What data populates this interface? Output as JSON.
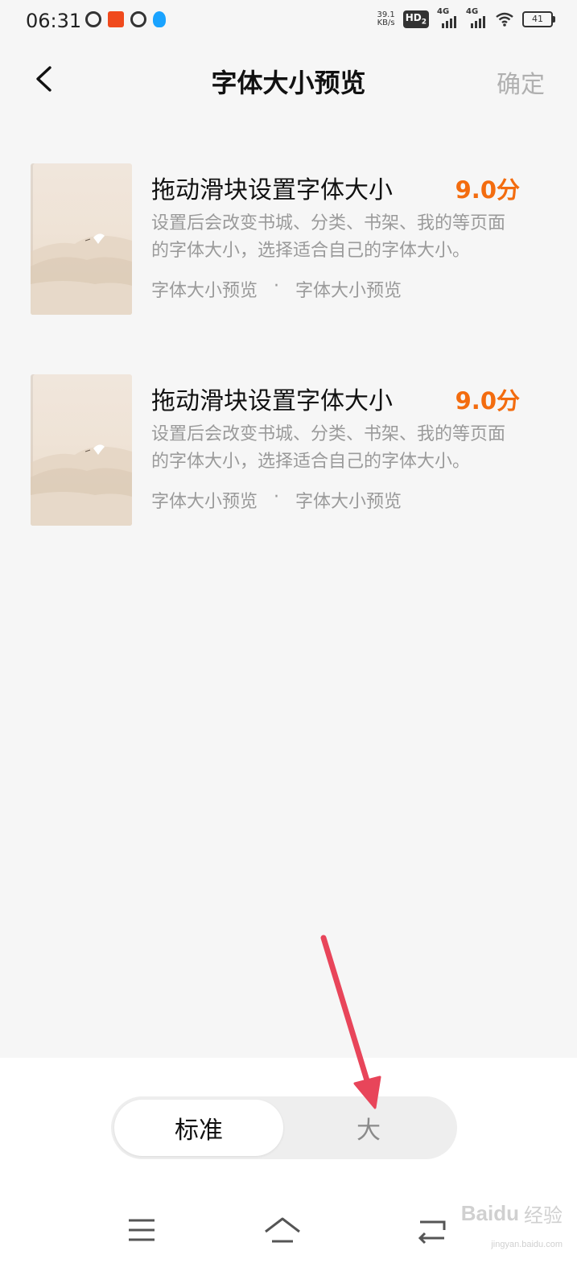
{
  "status_bar": {
    "time": "06:31",
    "net_speed_value": "39.1",
    "net_speed_unit": "KB/s",
    "hd_label": "HD",
    "hd_sub": "2",
    "sig1_label": "4G",
    "sig2_label": "4G",
    "battery": "41",
    "icons": [
      "q-app-icon",
      "red-app-icon",
      "clock-app-icon",
      "qq-icon",
      "hd-icon",
      "signal-icon",
      "signal-icon",
      "wifi-icon",
      "battery-icon"
    ]
  },
  "header": {
    "title": "字体大小预览",
    "confirm_label": "确定",
    "back_icon": "chevron-left-icon"
  },
  "books": [
    {
      "title": "拖动滑块设置字体大小",
      "score": "9.0分",
      "desc": "设置后会改变书城、分类、书架、我的等页面的字体大小，选择适合自己的字体大小。",
      "meta_left": "字体大小预览",
      "meta_dot": "·",
      "meta_right": "字体大小预览"
    },
    {
      "title": "拖动滑块设置字体大小",
      "score": "9.0分",
      "desc": "设置后会改变书城、分类、书架、我的等页面的字体大小，选择适合自己的字体大小。",
      "meta_left": "字体大小预览",
      "meta_dot": "·",
      "meta_right": "字体大小预览"
    }
  ],
  "font_size_selector": {
    "options": [
      "标准",
      "大"
    ],
    "selected": "标准"
  },
  "nav": {
    "icons": [
      "menu-icon",
      "home-icon",
      "back-icon"
    ]
  },
  "watermark": {
    "brand": "Baidu",
    "sub": "经验",
    "url": "jingyan.baidu.com"
  },
  "colors": {
    "accent_score": "#f36c0f",
    "annotation_arrow": "#e8455a",
    "background": "#f6f6f6"
  }
}
